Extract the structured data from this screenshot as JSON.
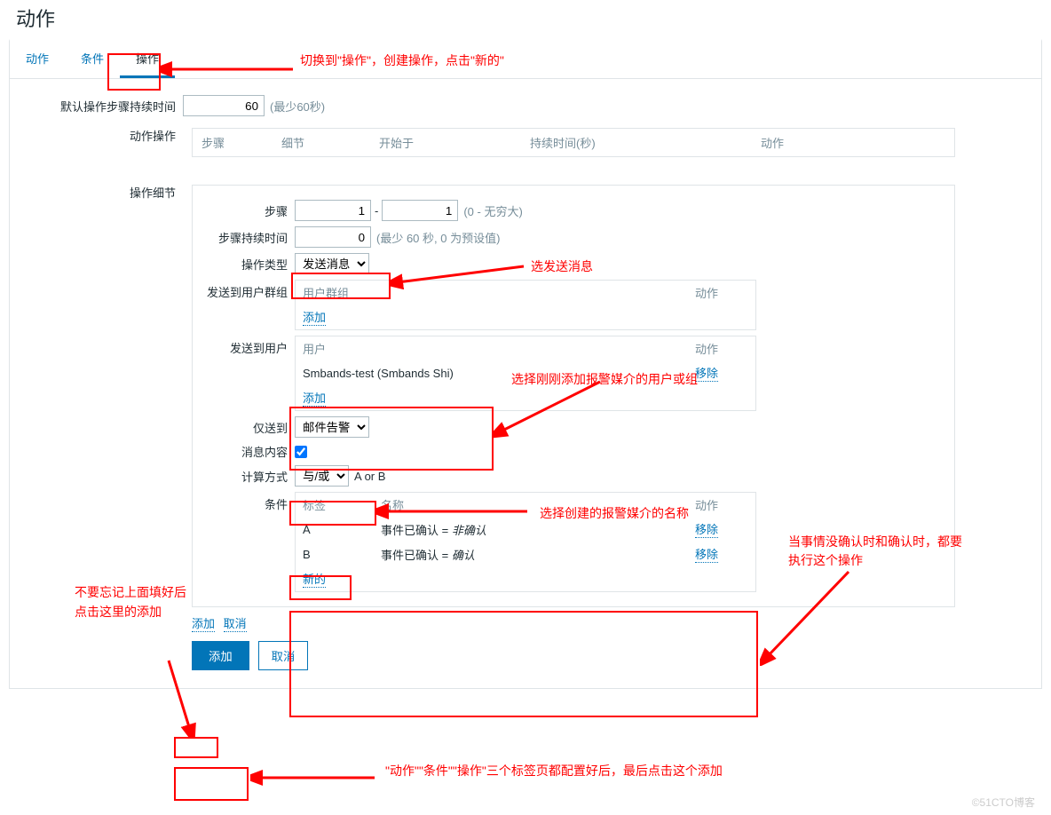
{
  "page_title": "动作",
  "tabs": {
    "action": "动作",
    "condition": "条件",
    "operation": "操作"
  },
  "default_step_duration": {
    "label": "默认操作步骤持续时间",
    "value": "60",
    "hint": "(最少60秒)"
  },
  "action_ops": {
    "label": "动作操作",
    "cols": {
      "step": "步骤",
      "detail": "细节",
      "start": "开始于",
      "duration": "持续时间(秒)",
      "action": "动作"
    }
  },
  "op_detail": {
    "label": "操作细节",
    "step": {
      "label": "步骤",
      "from": "1",
      "to": "1",
      "hint": "(0 - 无穷大)"
    },
    "step_duration": {
      "label": "步骤持续时间",
      "value": "0",
      "hint": "(最少 60 秒, 0 为预设值)"
    },
    "op_type": {
      "label": "操作类型",
      "selected": "发送消息"
    },
    "send_to_group": {
      "label": "发送到用户群组",
      "cols": {
        "group": "用户群组",
        "action": "动作"
      },
      "add": "添加"
    },
    "send_to_user": {
      "label": "发送到用户",
      "cols": {
        "user": "用户",
        "action": "动作"
      },
      "rows": [
        {
          "user": "Smbands-test (Smbands Shi)",
          "action": "移除"
        }
      ],
      "add": "添加"
    },
    "only_send_to": {
      "label": "仅送到",
      "selected": "邮件告警"
    },
    "msg_content": {
      "label": "消息内容"
    },
    "calc": {
      "label": "计算方式",
      "selected": "与/或",
      "text": "A or B"
    },
    "conditions": {
      "label": "条件",
      "cols": {
        "tag": "标签",
        "name": "名称",
        "action": "动作"
      },
      "rows": [
        {
          "tag": "A",
          "name_prefix": "事件已确认 = ",
          "name_val": "非确认",
          "action": "移除"
        },
        {
          "tag": "B",
          "name_prefix": "事件已确认 = ",
          "name_val": "确认",
          "action": "移除"
        }
      ],
      "new": "新的"
    }
  },
  "add_cancel": {
    "add": "添加",
    "cancel": "取消"
  },
  "final": {
    "add": "添加",
    "cancel": "取消"
  },
  "annotations": {
    "a1": "切换到\"操作\"，创建操作，点击\"新的\"",
    "a2": "选发送消息",
    "a3": "选择刚刚添加报警媒介的用户或组",
    "a4": "选择创建的报警媒介的名称",
    "a5": "当事情没确认时和确认时，都要执行这个操作",
    "a6": "不要忘记上面填好后点击这里的添加",
    "a7": "\"动作\"\"条件\"\"操作\"三个标签页都配置好后，最后点击这个添加"
  },
  "watermark": "©51CTO博客"
}
